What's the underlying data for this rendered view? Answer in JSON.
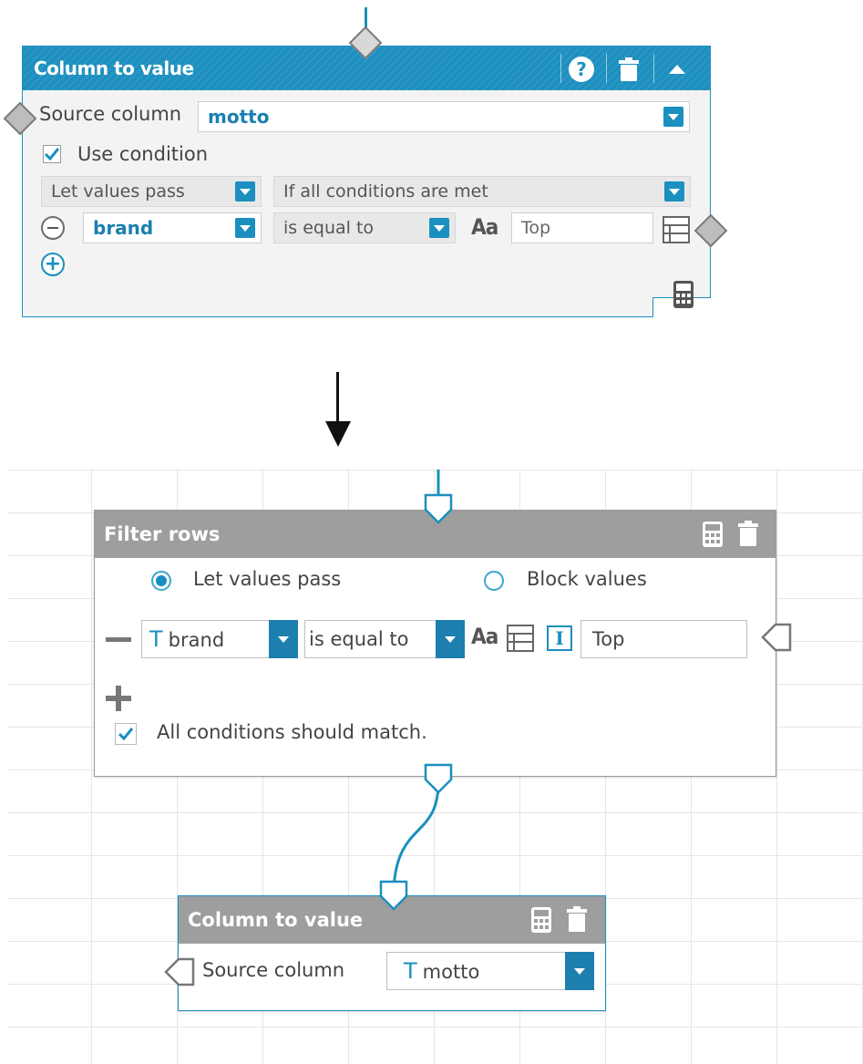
{
  "top_panel": {
    "title": "Column to value",
    "source_column_label": "Source column",
    "source_column_value": "motto",
    "use_condition_label": "Use condition",
    "use_condition_checked": true,
    "pass_mode_value": "Let values pass",
    "match_mode_value": "If all conditions are met",
    "condition": {
      "column": "brand",
      "operator": "is equal to",
      "case_icon": "Aa",
      "value": "Top"
    }
  },
  "bottom_filter": {
    "title": "Filter rows",
    "radio_pass_label": "Let values pass",
    "radio_block_label": "Block values",
    "radio_selected": "pass",
    "condition": {
      "column": "brand",
      "operator": "is equal to",
      "case_icon": "Aa",
      "value": "Top"
    },
    "all_match_label": "All conditions should match.",
    "all_match_checked": true
  },
  "bottom_column_to_value": {
    "title": "Column to value",
    "source_column_label": "Source column",
    "source_column_value": "motto"
  },
  "colors": {
    "accent_blue": "#1d8fc0",
    "new_header_gray": "#9e9e9e"
  },
  "icons": {
    "help": "?",
    "type_text": "T",
    "add": "+",
    "case_sensitive": "Aa",
    "text_cursor": "I"
  }
}
